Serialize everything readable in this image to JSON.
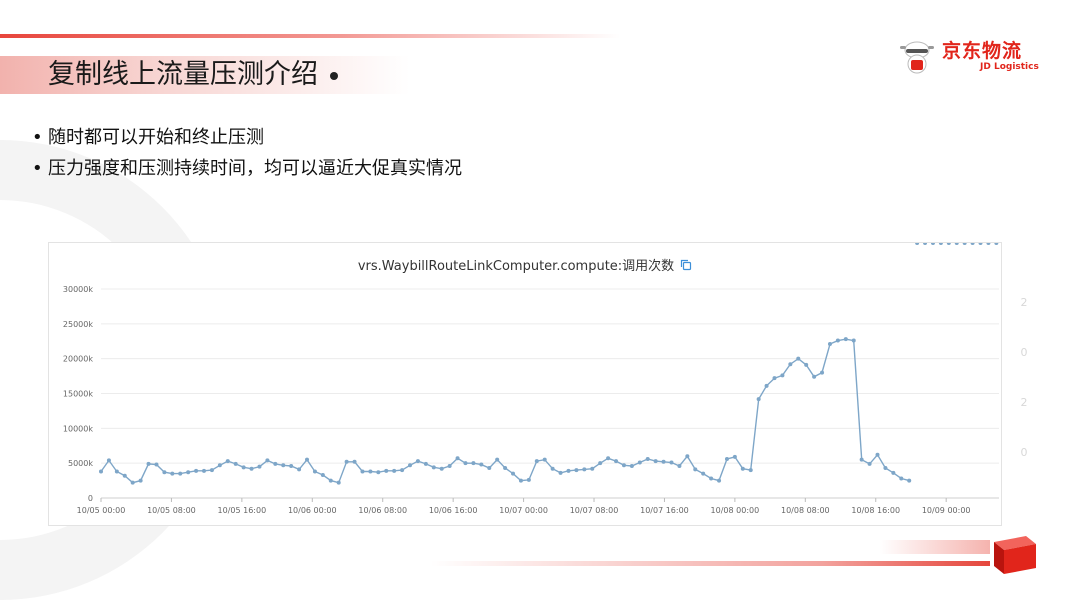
{
  "slide": {
    "title": "复制线上流量压测介绍",
    "bullets": [
      "随时都可以开始和终止压测",
      "压力强度和压测持续时间，均可以逼近大促真实情况"
    ],
    "side_marks": [
      "2",
      "0",
      "2",
      "0"
    ],
    "accent_color": "#e1251b"
  },
  "logo": {
    "name_cn": "京东物流",
    "name_en": "JD Logistics",
    "icon": "jd-mascot-icon"
  },
  "chart_data": {
    "type": "line",
    "title": "vrs.WaybillRouteLinkComputer.compute:调用次数",
    "title_icon": "copy-icon",
    "xlabel": "",
    "ylabel": "",
    "grid": true,
    "legend": "none",
    "ylim": [
      0,
      30000
    ],
    "y_ticks": [
      0,
      5000,
      10000,
      15000,
      20000,
      25000,
      30000
    ],
    "y_tick_labels": [
      "0",
      "5000k",
      "10000k",
      "15000k",
      "20000k",
      "25000k",
      "30000k"
    ],
    "x_tick_labels": [
      "10/05 00:00",
      "10/05 08:00",
      "10/05 16:00",
      "10/06 00:00",
      "10/06 08:00",
      "10/06 16:00",
      "10/07 00:00",
      "10/07 08:00",
      "10/07 16:00",
      "10/08 00:00",
      "10/08 08:00",
      "10/08 16:00",
      "10/09 00:00"
    ],
    "x_tick_hours": [
      0,
      8,
      16,
      24,
      32,
      40,
      48,
      56,
      64,
      72,
      80,
      88,
      96
    ],
    "x_range_hours": [
      0,
      102
    ],
    "line_color": "#7ea6c8",
    "series": [
      {
        "x_hours": [
          0,
          0.9,
          1.8,
          2.7,
          3.6,
          4.5,
          5.4,
          6.3,
          7.2,
          8.1,
          9.0,
          9.9,
          10.8,
          11.7,
          12.6,
          13.5,
          14.4,
          15.3,
          16.2,
          17.1,
          18.0,
          18.9,
          19.8,
          20.7,
          21.6,
          22.5,
          23.4,
          24.3,
          25.2,
          26.1,
          27.0,
          27.9,
          28.8,
          29.7,
          30.6,
          31.5,
          32.4,
          33.3,
          34.2,
          35.1,
          36.0,
          36.9,
          37.8,
          38.7,
          39.6,
          40.5,
          41.4,
          42.3,
          43.2,
          44.1,
          45.0,
          45.9,
          46.8,
          47.7,
          48.6,
          49.5,
          50.4,
          51.3,
          52.2,
          53.1,
          54.0,
          54.9,
          55.8,
          56.7,
          57.6,
          58.5,
          59.4,
          60.3,
          61.2,
          62.1,
          63.0,
          63.9,
          64.8,
          65.7,
          66.6,
          67.5,
          68.4,
          69.3,
          70.2,
          71.1,
          72.0,
          72.9,
          73.8,
          74.7,
          75.6,
          76.5,
          77.4,
          78.3,
          79.2,
          80.1,
          81.0,
          81.9,
          82.8,
          83.7,
          84.6,
          85.5,
          86.4,
          87.3,
          88.2,
          89.1,
          90.0,
          90.9,
          91.8,
          92.7,
          93.6,
          94.5,
          95.4,
          96.3,
          97.2,
          98.1,
          99.0,
          99.9,
          100.8,
          101.7
        ],
        "values": [
          3800,
          5400,
          3800,
          3200,
          2200,
          2500,
          4900,
          4800,
          3700,
          3500,
          3500,
          3700,
          3900,
          3900,
          4000,
          4700,
          5300,
          4900,
          4400,
          4200,
          4500,
          5400,
          4900,
          4700,
          4600,
          4100,
          5500,
          3800,
          3300,
          2500,
          2200,
          5200,
          5200,
          3800,
          3800,
          3700,
          3900,
          3900,
          4000,
          4700,
          5300,
          4900,
          4400,
          4200,
          4600,
          5700,
          5000,
          5000,
          4800,
          4300,
          5500,
          4300,
          3500,
          2500,
          2600,
          5300,
          5500,
          4200,
          3600,
          3900,
          4000,
          4100,
          4200,
          5000,
          5700,
          5300,
          4700,
          4600,
          5100,
          5600,
          5300,
          5200,
          5100,
          4600,
          6000,
          4100,
          3500,
          2800,
          2500,
          5600,
          5900,
          4200,
          4000,
          14200,
          16100,
          17200,
          17600,
          19200,
          20000,
          19100,
          17400,
          18000,
          22100,
          22600,
          22800,
          22600,
          5500,
          4900,
          6200,
          4300,
          3600,
          2800,
          2500
        ]
      }
    ]
  }
}
